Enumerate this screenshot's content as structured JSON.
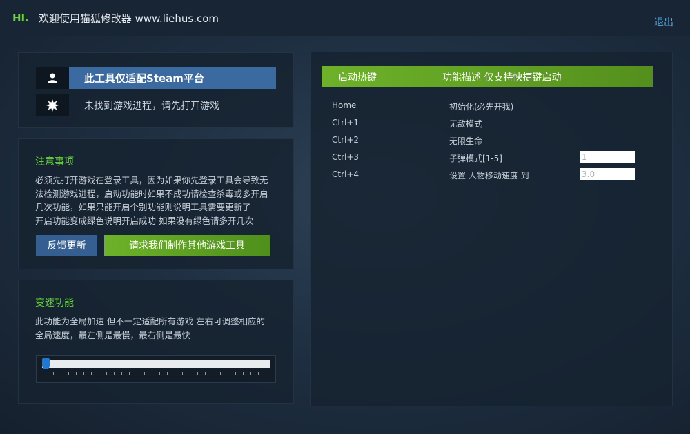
{
  "titlebar": {
    "hi": "HI.",
    "title": "欢迎使用猫狐修改器 www.liehus.com",
    "logout": "退出"
  },
  "status": {
    "platform": "此工具仅适配Steam平台",
    "process": "未找到游戏进程，请先打开游戏",
    "user_icon": "user-icon",
    "gear_icon": "gear-icon"
  },
  "notice": {
    "title": "注意事项",
    "lines": [
      "必须先打开游戏在登录工具，因为如果你先登录工具会导致无",
      "法检测游戏进程，启动功能时如果不成功请检查杀毒或多开启",
      "几次功能，如果只能开启个别功能则说明工具需要更新了",
      "开启功能变成绿色说明开启成功 如果没有绿色请多开几次"
    ],
    "feedback_button": "反馈更新",
    "request_button": "请求我们制作其他游戏工具"
  },
  "speed": {
    "title": "变速功能",
    "lines": [
      "此功能为全局加速 但不一定适配所有游戏 左右可调整相应的",
      "全局速度，最左侧是最慢，最右侧是最快"
    ],
    "slider_value": 0
  },
  "hotkeys": {
    "header_key": "启动热键",
    "header_desc": "功能描述 仅支持快捷键启动",
    "rows": [
      {
        "key": "Home",
        "desc": "初始化(必先开我)"
      },
      {
        "key": "Ctrl+1",
        "desc": "无敌模式"
      },
      {
        "key": "Ctrl+2",
        "desc": "无限生命"
      },
      {
        "key": "Ctrl+3",
        "desc": "子弹模式[1-5]",
        "input": "1"
      },
      {
        "key": "Ctrl+4",
        "desc": "设置 人物移动速度 到",
        "input": "3.0"
      }
    ]
  },
  "colors": {
    "accent_green": "#6db229",
    "accent_blue": "#3a6aa0",
    "title_green": "#67d33c"
  }
}
